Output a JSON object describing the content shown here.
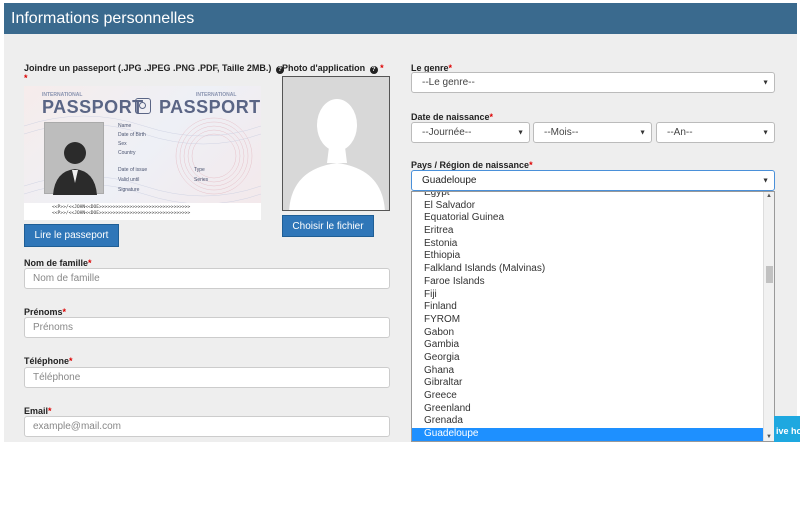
{
  "header": {
    "title": "Informations personnelles"
  },
  "passport_upload": {
    "label": "Joindre un passeport (.JPG .JPEG .PNG .PDF, Taille 2MB.)",
    "card": {
      "intl_left": "INTERNATIONAL",
      "intl_right": "INTERNATIONAL",
      "title_left": "PASSPORT",
      "title_right": "PASSPORT",
      "fields": [
        "Name",
        "Date of Birth",
        "Sex",
        "Country"
      ],
      "date_issue": "Date of issue",
      "valid_until": "Valid until",
      "signature": "Signature",
      "type": "Type",
      "series": "Series",
      "mrz_line1": "<<P>>/<<JOHN<<DOE>>>>>>>>>>>>>>>>>>>>>>>>>>>>>>>>>",
      "mrz_line2": "<<P>>/<<JOHN<<DOE>>>>>>>>>>>>>>>>>>>>>>>>>>>>>>>>>"
    },
    "read_button": "Lire le passeport"
  },
  "photo": {
    "label": "Photo d'application",
    "choose_button": "Choisir le fichier"
  },
  "last_name": {
    "label": "Nom de famille",
    "placeholder": "Nom de famille"
  },
  "first_names": {
    "label": "Prénoms",
    "placeholder": "Prénoms"
  },
  "phone": {
    "label": "Téléphone",
    "placeholder": "Téléphone"
  },
  "email": {
    "label": "Email",
    "placeholder": "example@mail.com"
  },
  "gender": {
    "label": "Le genre",
    "value": "--Le genre--"
  },
  "birth_date": {
    "label": "Date de naissance",
    "day": "--Journée--",
    "month": "--Mois--",
    "year": "--An--"
  },
  "birth_country": {
    "label": "Pays / Région de naissance",
    "value": "Guadeloupe",
    "options": [
      "Egypt",
      "El Salvador",
      "Equatorial Guinea",
      "Eritrea",
      "Estonia",
      "Ethiopia",
      "Falkland Islands (Malvinas)",
      "Faroe Islands",
      "Fiji",
      "Finland",
      "FYROM",
      "Gabon",
      "Gambia",
      "Georgia",
      "Ghana",
      "Gibraltar",
      "Greece",
      "Greenland",
      "Grenada",
      "Guadeloupe"
    ],
    "selected_index": 19
  },
  "required_mark": "*",
  "chat_widget": {
    "label": "ive ho"
  },
  "colors": {
    "header_bg": "#3a6a8e",
    "button_bg": "#2f76b8",
    "selected_bg": "#1e90ff",
    "required": "#dd0000"
  }
}
